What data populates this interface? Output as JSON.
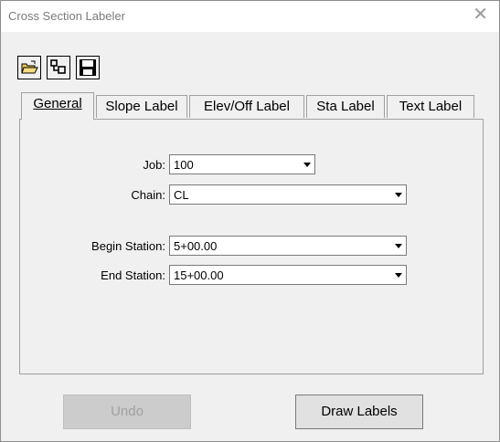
{
  "window": {
    "title": "Cross Section Labeler"
  },
  "toolbar": {
    "open_icon": "open-folder-icon",
    "copy_icon": "structure-icon",
    "save_icon": "save-icon"
  },
  "tabs": [
    {
      "label": "General",
      "active": true
    },
    {
      "label": "Slope Label",
      "active": false
    },
    {
      "label": "Elev/Off Label",
      "active": false
    },
    {
      "label": "Sta Label",
      "active": false
    },
    {
      "label": "Text Label",
      "active": false
    }
  ],
  "form": {
    "job": {
      "label": "Job:",
      "value": "100"
    },
    "chain": {
      "label": "Chain:",
      "value": "CL"
    },
    "begin_station": {
      "label": "Begin Station:",
      "value": "5+00.00"
    },
    "end_station": {
      "label": "End Station:",
      "value": "15+00.00"
    }
  },
  "buttons": {
    "undo": "Undo",
    "draw": "Draw Labels"
  }
}
